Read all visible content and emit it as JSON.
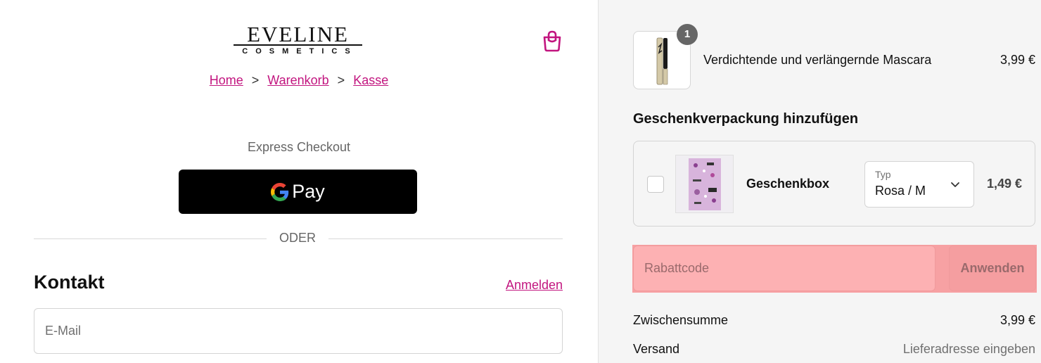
{
  "header": {
    "logo_main": "EVELINE",
    "logo_sub": "COSMETICS",
    "breadcrumb": [
      "Home",
      "Warenkorb",
      "Kasse"
    ],
    "breadcrumb_separator": ">"
  },
  "express": {
    "label": "Express Checkout",
    "gpay_label": "Pay",
    "or_label": "ODER"
  },
  "contact": {
    "title": "Kontakt",
    "login_link": "Anmelden",
    "email_placeholder": "E-Mail"
  },
  "summary": {
    "product": {
      "quantity": "1",
      "name": "Verdichtende und verlängernde Mascara",
      "price": "3,99 €"
    },
    "gift_section_title": "Geschenkverpackung hinzufügen",
    "gift": {
      "name": "Geschenkbox",
      "select_label": "Typ",
      "select_value": "Rosa / M",
      "price": "1,49 €",
      "checked": false
    },
    "discount_placeholder": "Rabattcode",
    "apply_label": "Anwenden",
    "subtotal_label": "Zwischensumme",
    "subtotal_value": "3,99 €",
    "shipping_label": "Versand",
    "shipping_value": "Lieferadresse eingeben"
  },
  "colors": {
    "accent": "#c2157f",
    "highlight": "#f7a1a3",
    "panel_bg": "#f5f5f5"
  }
}
